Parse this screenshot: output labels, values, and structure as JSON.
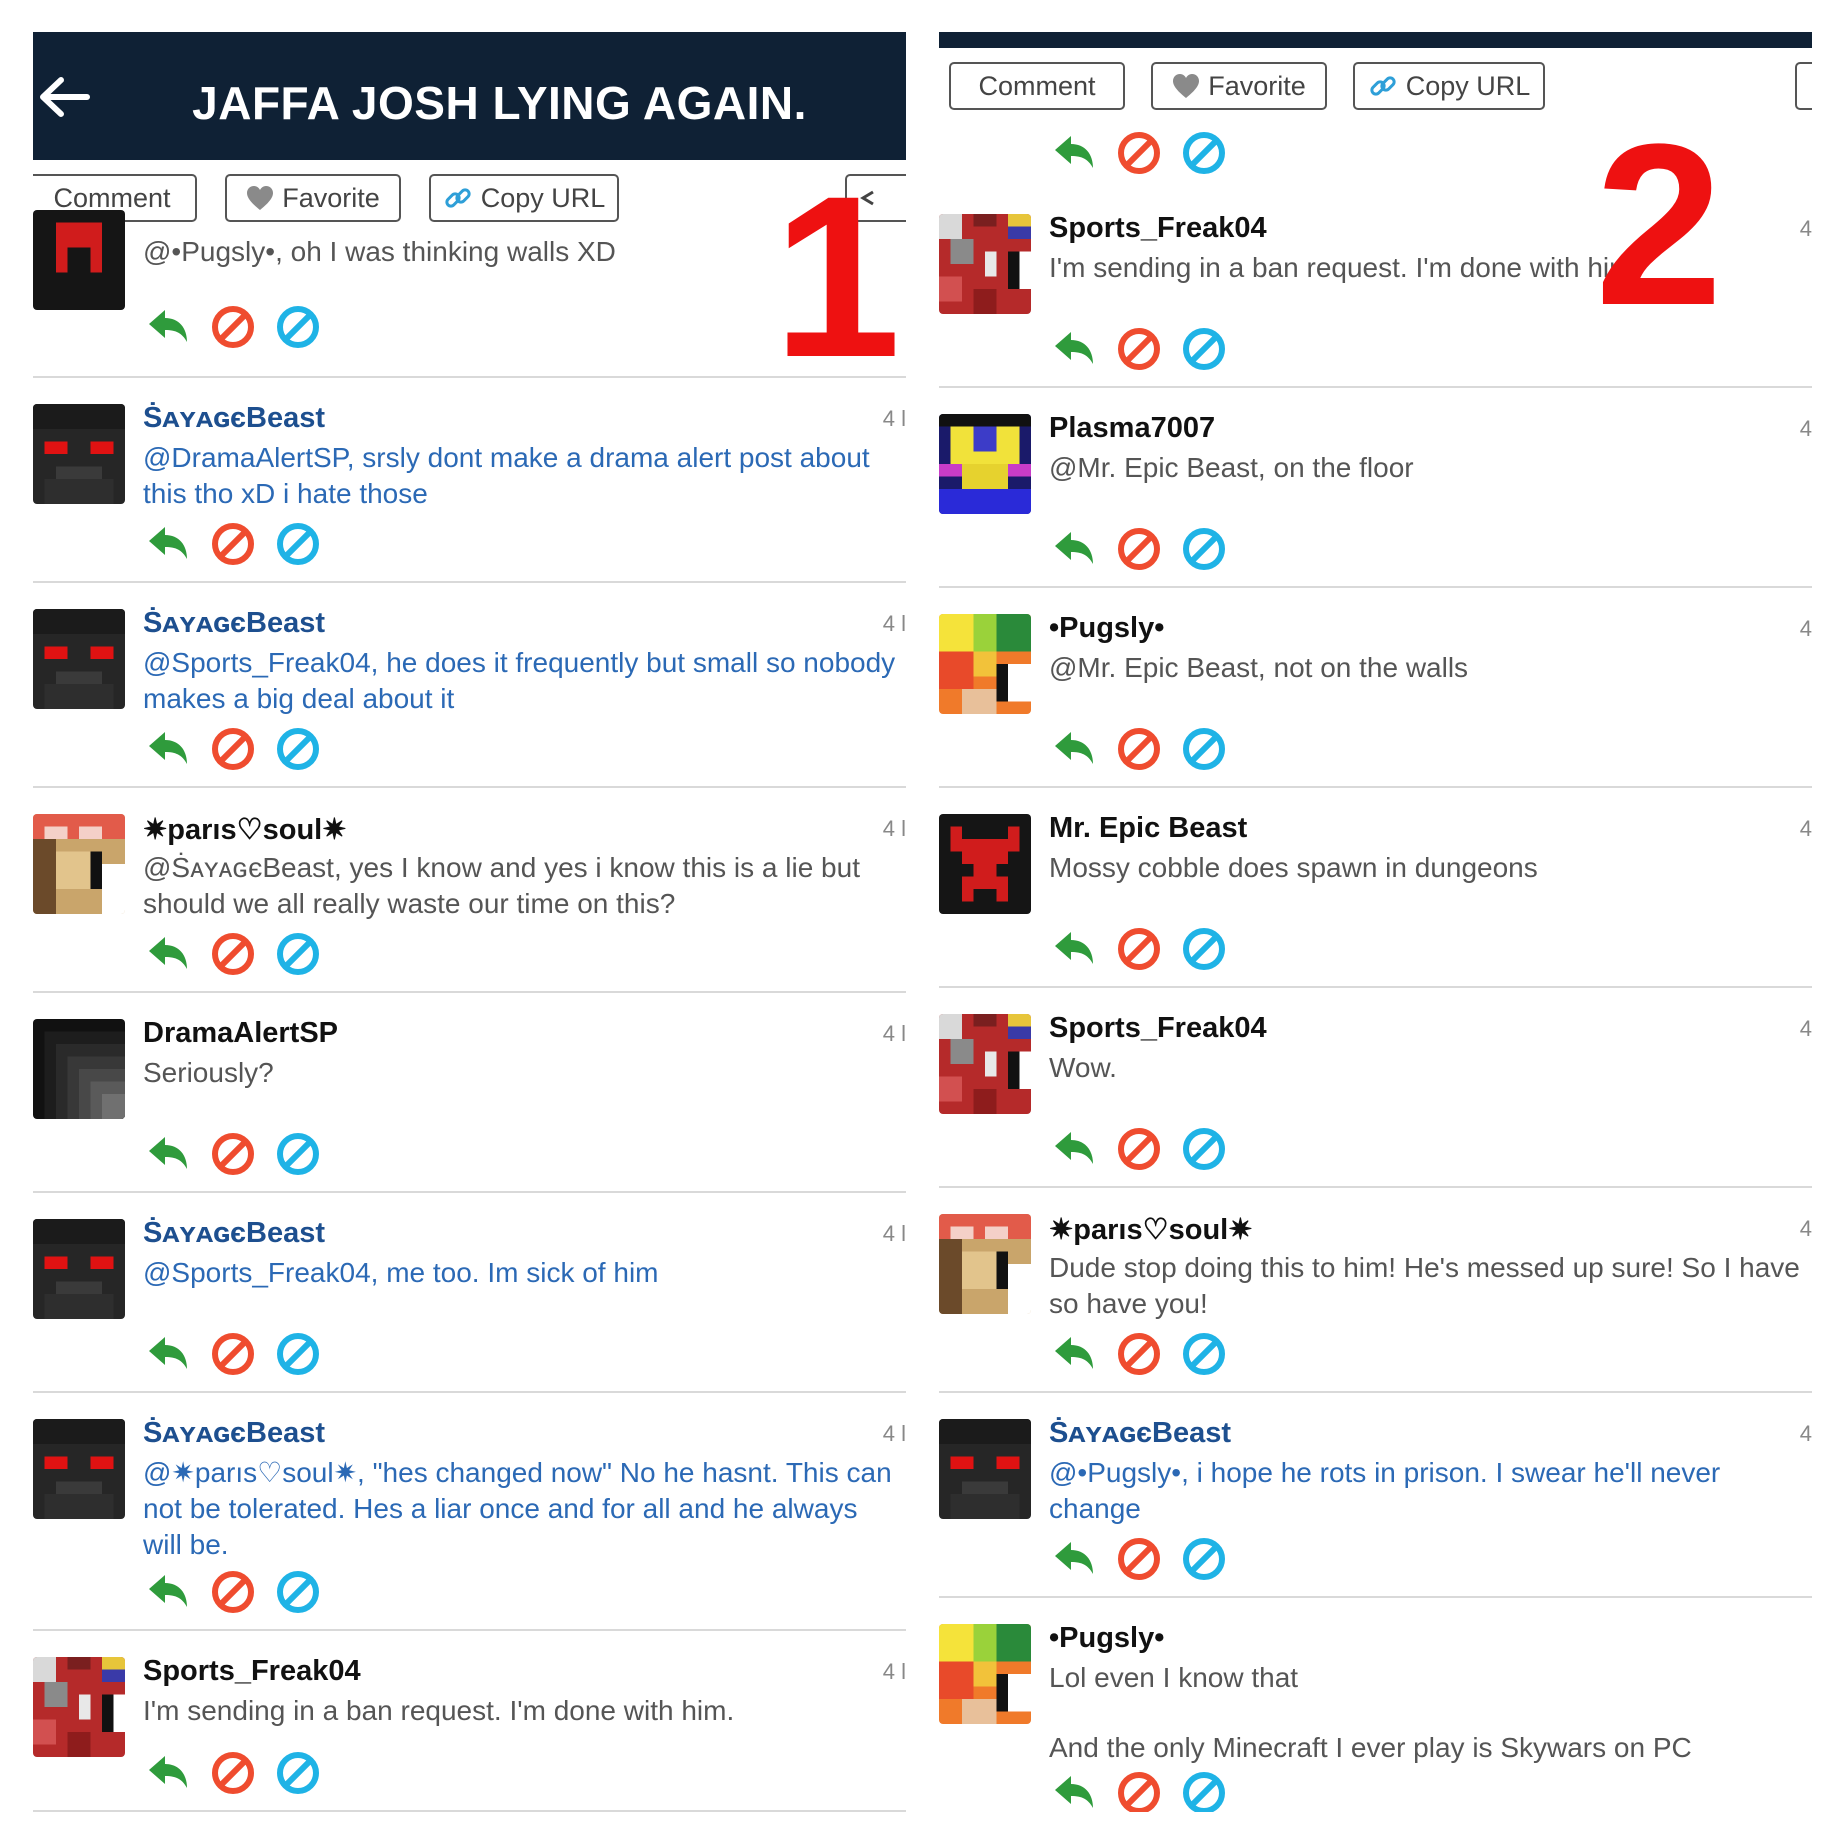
{
  "panel1": {
    "title": "JAFFA JOSH LYING AGAIN.",
    "label": "1",
    "toolbar": {
      "comment": "Comment",
      "favorite": "Favorite",
      "copy_url": "Copy URL"
    },
    "comments": [
      {
        "text": "@•Pugsly•, oh I was thinking walls XD"
      },
      {
        "user": "ṠᴀʏᴀɢєBeast",
        "time": "4 l",
        "text": "@DramaAlertSP, srsly dont make a drama alert post about this tho xD i hate those"
      },
      {
        "user": "ṠᴀʏᴀɢєBeast",
        "time": "4 l",
        "text": "@Sports_Freak04, he does it frequently but small so nobody makes a big deal about it"
      },
      {
        "user": "✷parıs♡soul✷",
        "time": "4 l",
        "text": "@ṠᴀʏᴀɢєBeast, yes I know and yes i know this is a lie but should we all really waste our time on this?"
      },
      {
        "user": "DramaAlertSP",
        "time": "4 l",
        "text": "Seriously?"
      },
      {
        "user": "ṠᴀʏᴀɢєBeast",
        "time": "4 l",
        "text": "@Sports_Freak04, me too. Im sick of him"
      },
      {
        "user": "ṠᴀʏᴀɢєBeast",
        "time": "4 l",
        "text": "@✷parıs♡soul✷, \"hes changed now\" No he hasnt. This can not be tolerated. Hes a liar once and for all and he always will be."
      },
      {
        "user": "Sports_Freak04",
        "time": "4 l",
        "text": "I'm sending in a ban request. I'm done with him."
      }
    ]
  },
  "panel2": {
    "label": "2",
    "toolbar": {
      "comment": "Comment",
      "favorite": "Favorite",
      "copy_url": "Copy URL"
    },
    "comments": [
      {
        "user": "Sports_Freak04",
        "time": "4",
        "text": "I'm sending in a ban request. I'm done with him."
      },
      {
        "user": "Plasma7007",
        "time": "4",
        "text": "@Mr. Epic Beast, on the floor"
      },
      {
        "user": "•Pugsly•",
        "time": "4",
        "text": "@Mr. Epic Beast, not on the walls"
      },
      {
        "user": "Mr. Epic Beast",
        "time": "4",
        "text": "Mossy cobble does spawn in dungeons"
      },
      {
        "user": "Sports_Freak04",
        "time": "4",
        "text": "Wow."
      },
      {
        "user": "✷parıs♡soul✷",
        "time": "4",
        "text": "Dude stop doing this to him! He's messed up sure! So I have so have you!"
      },
      {
        "user": "ṠᴀʏᴀɢєBeast",
        "time": "4",
        "text": "@•Pugsly•, i hope he rots in prison. I swear he'll never change"
      },
      {
        "user": "•Pugsly•",
        "time": "",
        "text": "Lol even I know that",
        "text2": "And the only Minecraft I ever play is Skywars on PC"
      }
    ]
  },
  "icons": {
    "reply": "reply-arrow-icon",
    "block": "block-icon",
    "dislike": "dislike-icon",
    "heart": "heart-icon",
    "link": "link-icon",
    "back": "back-arrow-icon",
    "share": "share-icon"
  },
  "colors": {
    "header": "#0f2135",
    "reply": "#2f9b3c",
    "block": "#ef4c2f",
    "dislike": "#1fb3e6",
    "label": "#ee1111",
    "blue_name": "#1d4f8f",
    "blue_text": "#2b69b5"
  }
}
